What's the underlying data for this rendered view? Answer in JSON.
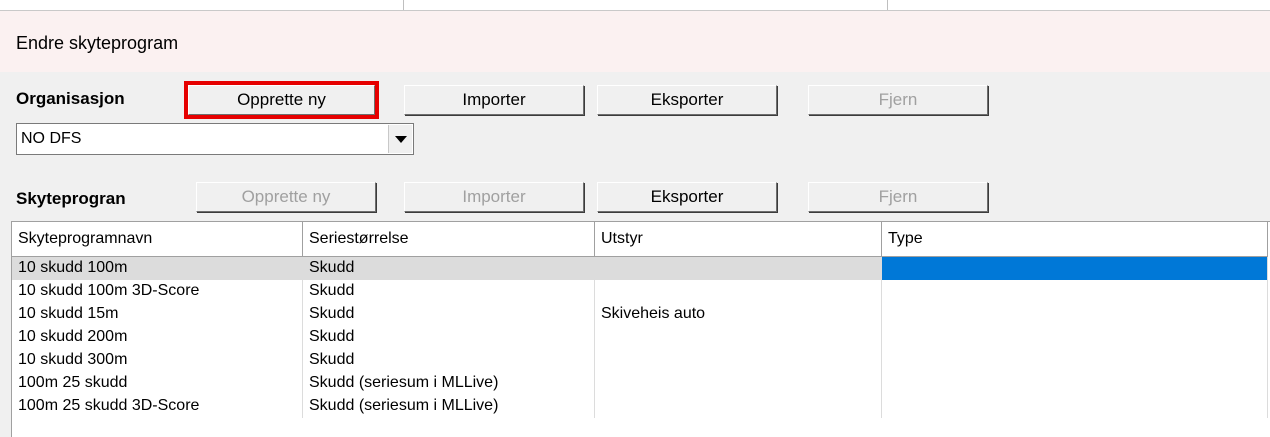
{
  "window": {
    "title": "Endre skyteprogram"
  },
  "organisation": {
    "label": "Organisasjon",
    "buttons": {
      "create": "Opprette ny",
      "import": "Importer",
      "export": "Eksporter",
      "remove": "Fjern"
    },
    "selected": "NO DFS"
  },
  "program": {
    "label": "Skyteprogran",
    "buttons": {
      "create": "Opprette ny",
      "import": "Importer",
      "export": "Eksporter",
      "remove": "Fjern"
    }
  },
  "table": {
    "columns": [
      "Skyteprogramnavn",
      "Seriestørrelse",
      "Utstyr",
      "Type"
    ],
    "rows": [
      [
        "10 skudd 100m",
        "Skudd",
        "",
        ""
      ],
      [
        "10 skudd 100m 3D-Score",
        "Skudd",
        "",
        ""
      ],
      [
        "10 skudd 15m",
        "Skudd",
        "Skiveheis auto",
        ""
      ],
      [
        "10 skudd 200m",
        "Skudd",
        "",
        ""
      ],
      [
        "10 skudd 300m",
        "Skudd",
        "",
        ""
      ],
      [
        "100m 25 skudd",
        "Skudd (seriesum i MLLive)",
        "",
        ""
      ],
      [
        "100m 25 skudd 3D-Score",
        "Skudd (seriesum i MLLive)",
        "",
        ""
      ]
    ],
    "selected_row": 0
  },
  "colors": {
    "selection": "#0078d7",
    "highlight_box": "#e60000"
  }
}
